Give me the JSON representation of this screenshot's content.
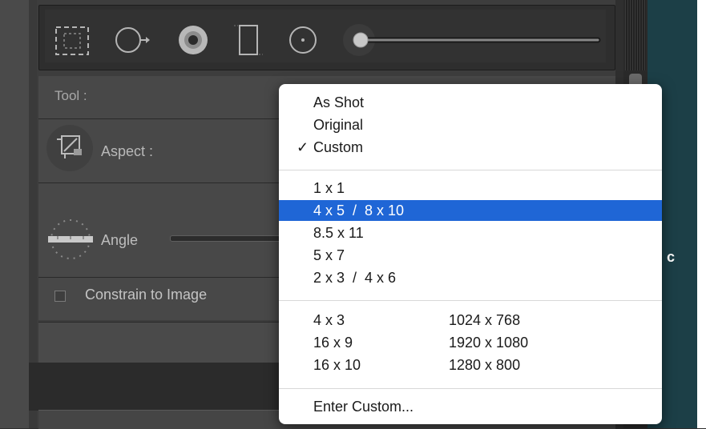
{
  "panel": {
    "tool_label": "Tool :",
    "aspect_label": "Aspect :",
    "angle_label": "Angle",
    "constrain_label": "Constrain to Image",
    "constrain_checked": false
  },
  "toolbar": {
    "icons": [
      "crop-overlay-icon",
      "spot-removal-icon",
      "red-eye-icon",
      "graduated-filter-icon",
      "radial-filter-icon",
      "adjustment-brush-icon"
    ]
  },
  "aspect_menu": {
    "group1": [
      {
        "label": "As Shot",
        "checked": false
      },
      {
        "label": "Original",
        "checked": false
      },
      {
        "label": "Custom",
        "checked": true
      }
    ],
    "check_mark": "✓",
    "group2": [
      {
        "label": "1 x 1",
        "selected": false
      },
      {
        "label": "4 x 5  /  8 x 10",
        "selected": true
      },
      {
        "label": "8.5 x 11",
        "selected": false
      },
      {
        "label": "5 x 7",
        "selected": false
      },
      {
        "label": "2 x 3  /  4 x 6",
        "selected": false
      }
    ],
    "group3": [
      {
        "ratio": "4 x 3",
        "resolution": "1024 x 768"
      },
      {
        "ratio": "16 x 9",
        "resolution": "1920 x 1080"
      },
      {
        "ratio": "16 x 10",
        "resolution": "1280 x 800"
      }
    ],
    "enter_custom": "Enter Custom..."
  },
  "background": {
    "right_letter": "c"
  },
  "colors": {
    "highlight": "#1f66d6",
    "panel": "#484848",
    "menu_bg": "#ffffff"
  }
}
